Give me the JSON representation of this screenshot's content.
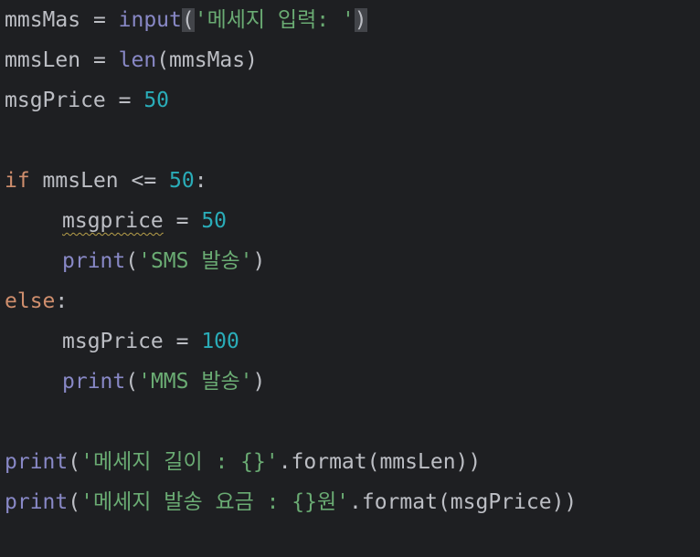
{
  "lines": [
    {
      "segments": [
        {
          "t": "mmsMas",
          "c": "id"
        },
        {
          "t": " = ",
          "c": "op"
        },
        {
          "t": "input",
          "c": "bi"
        },
        {
          "t": "(",
          "c": "punc",
          "hl": true
        },
        {
          "t": "'메세지 입력: '",
          "c": "str"
        },
        {
          "t": ")",
          "c": "punc",
          "hl": true
        }
      ]
    },
    {
      "segments": [
        {
          "t": "mmsLen",
          "c": "id"
        },
        {
          "t": " = ",
          "c": "op"
        },
        {
          "t": "len",
          "c": "bi"
        },
        {
          "t": "(mmsMas)",
          "c": "punc"
        }
      ]
    },
    {
      "segments": [
        {
          "t": "msgPrice",
          "c": "id"
        },
        {
          "t": " = ",
          "c": "op"
        },
        {
          "t": "50",
          "c": "num"
        }
      ]
    },
    {
      "segments": []
    },
    {
      "segments": [
        {
          "t": "if",
          "c": "kw"
        },
        {
          "t": " mmsLen <= ",
          "c": "id"
        },
        {
          "t": "50",
          "c": "num"
        },
        {
          "t": ":",
          "c": "punc"
        }
      ]
    },
    {
      "indent": 1,
      "segments": [
        {
          "t": "msgprice",
          "c": "id",
          "squiggle": true
        },
        {
          "t": " = ",
          "c": "op"
        },
        {
          "t": "50",
          "c": "num"
        }
      ]
    },
    {
      "indent": 1,
      "segments": [
        {
          "t": "print",
          "c": "bi"
        },
        {
          "t": "(",
          "c": "punc"
        },
        {
          "t": "'SMS 발송'",
          "c": "str"
        },
        {
          "t": ")",
          "c": "punc"
        }
      ]
    },
    {
      "segments": [
        {
          "t": "else",
          "c": "kw"
        },
        {
          "t": ":",
          "c": "punc"
        }
      ]
    },
    {
      "indent": 1,
      "segments": [
        {
          "t": "msgPrice",
          "c": "id"
        },
        {
          "t": " = ",
          "c": "op"
        },
        {
          "t": "100",
          "c": "num"
        }
      ]
    },
    {
      "indent": 1,
      "segments": [
        {
          "t": "print",
          "c": "bi"
        },
        {
          "t": "(",
          "c": "punc"
        },
        {
          "t": "'MMS 발송'",
          "c": "str"
        },
        {
          "t": ")",
          "c": "punc"
        }
      ]
    },
    {
      "segments": []
    },
    {
      "segments": [
        {
          "t": "print",
          "c": "bi"
        },
        {
          "t": "(",
          "c": "punc"
        },
        {
          "t": "'메세지 길이 : {}'",
          "c": "str"
        },
        {
          "t": ".format(mmsLen))",
          "c": "punc"
        }
      ]
    },
    {
      "segments": [
        {
          "t": "print",
          "c": "bi"
        },
        {
          "t": "(",
          "c": "punc"
        },
        {
          "t": "'메세지 발송 요금 : {}원'",
          "c": "str"
        },
        {
          "t": ".format(msgPrice))",
          "c": "punc"
        }
      ]
    }
  ],
  "colors": {
    "background": "#1e1f22",
    "identifier": "#bcbec4",
    "keyword": "#cf8e6d",
    "builtin": "#8888c6",
    "number": "#2aacb8",
    "string": "#6aab73",
    "bracket_highlight": "#43454a",
    "warning_squiggle": "#b8a04a"
  }
}
